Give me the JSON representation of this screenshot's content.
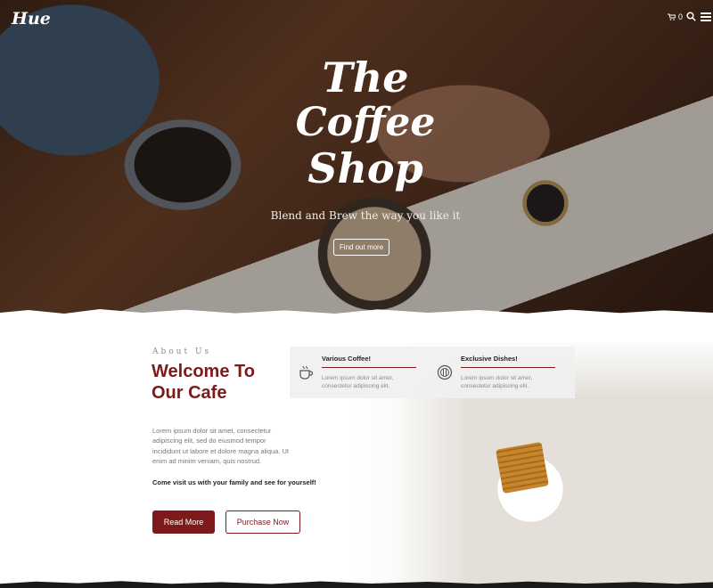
{
  "header": {
    "logo": "Hue",
    "cart_count": "0"
  },
  "hero": {
    "title_line1": "The",
    "title_line2": "Coffee",
    "title_line3": "Shop",
    "tagline": "Blend and Brew the way you like it",
    "button_label": "Find out more"
  },
  "about": {
    "label": "About Us",
    "heading_line1": "Welcome To",
    "heading_line2": "Our Cafe",
    "body": "Lorem ipsum dolor sit amet, consectetur adipiscing elit, sed do eiusmod tempor incididunt ut labore et dolore magna aliqua. Ut enim ad minim veniam, quis nostrud.",
    "cta": "Come visit us with your family and see for yourself!",
    "read_more": "Read More",
    "purchase": "Purchase Now"
  },
  "features": [
    {
      "title": "Various Coffee!",
      "desc": "Lorem ipsum dolor sit amet, consectetur adipiscing elit.",
      "icon": "coffee-cup-icon"
    },
    {
      "title": "Exclusive Dishes!",
      "desc": "Lorem ipsum dolor sit amet, consectetur adipiscing elit.",
      "icon": "dish-icon"
    }
  ],
  "colors": {
    "accent": "#7d1a1a"
  }
}
